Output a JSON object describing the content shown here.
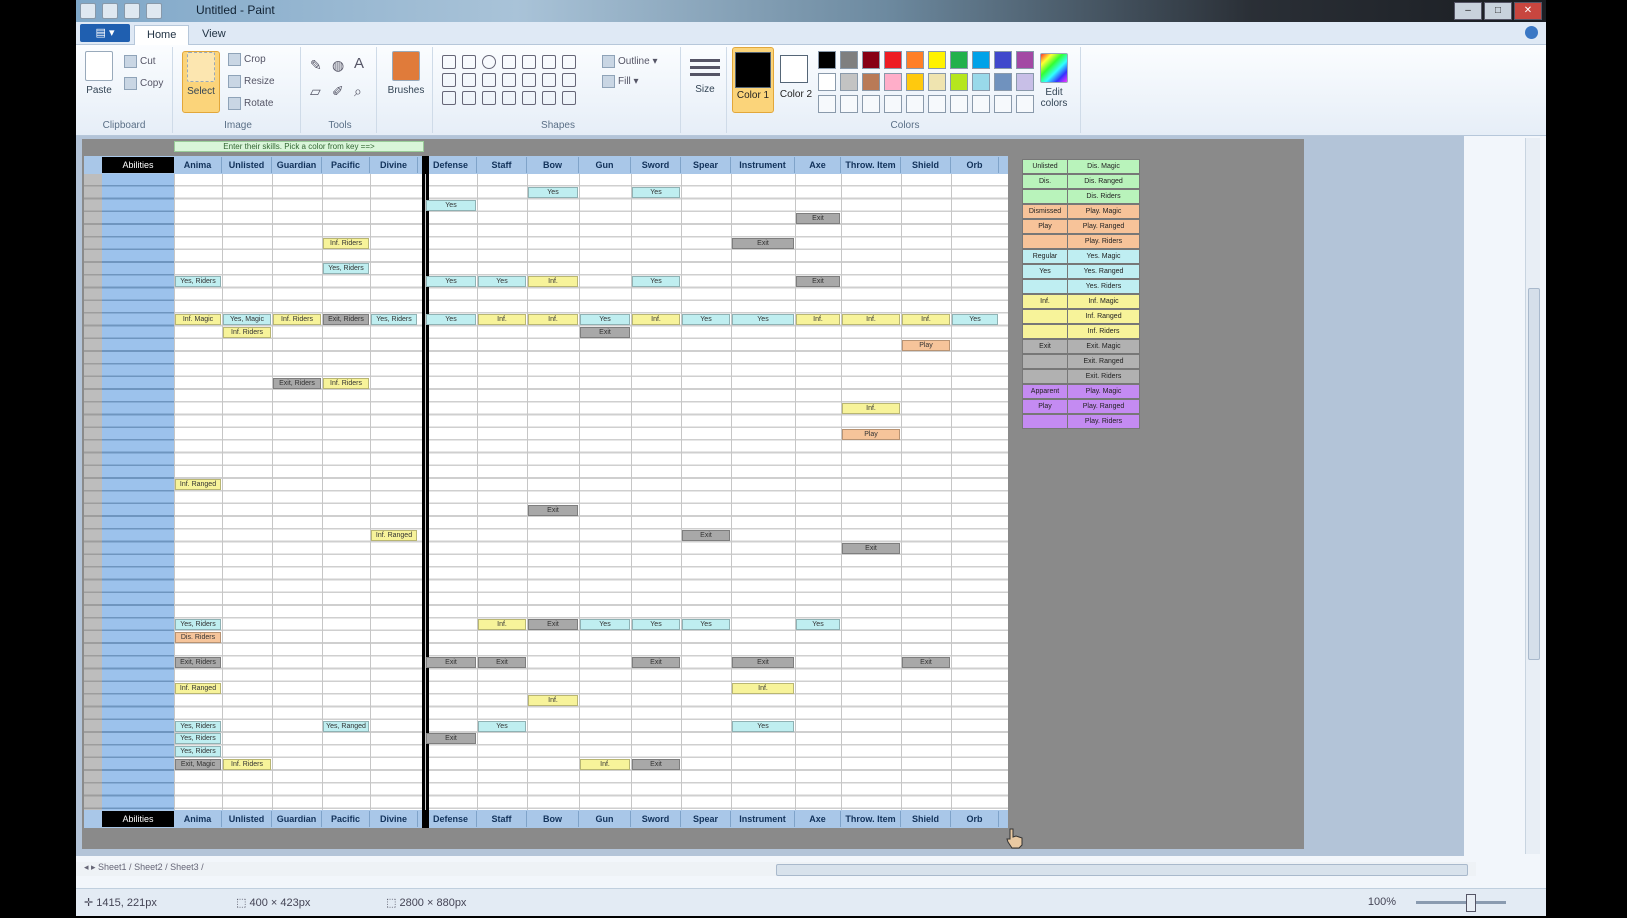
{
  "window": {
    "title": "Untitled - Paint"
  },
  "tabs": [
    {
      "label": "Home"
    },
    {
      "label": "View"
    }
  ],
  "ribbon": {
    "clipboard": {
      "label": "Clipboard",
      "paste": "Paste",
      "cut": "Cut",
      "copy": "Copy"
    },
    "image": {
      "label": "Image",
      "select": "Select",
      "crop": "Crop",
      "resize": "Resize",
      "rotate": "Rotate"
    },
    "tools": {
      "label": "Tools"
    },
    "brushes": {
      "label": "Brushes"
    },
    "shapes": {
      "label": "Shapes",
      "outline": "Outline",
      "fill": "Fill"
    },
    "size": {
      "label": "Size"
    },
    "colors": {
      "label": "Colors",
      "color1": "Color 1",
      "color2": "Color 2",
      "edit": "Edit colors"
    },
    "palette": [
      "#000000",
      "#7f7f7f",
      "#880015",
      "#ed1c24",
      "#ff7f27",
      "#fff200",
      "#22b14c",
      "#00a2e8",
      "#3f48cc",
      "#a349a4",
      "#ffffff",
      "#c3c3c3",
      "#b97a57",
      "#ffaec9",
      "#ffc90e",
      "#efe4b0",
      "#b5e61d",
      "#99d9ea",
      "#7092be",
      "#c8bfe7"
    ]
  },
  "sheet": {
    "note": "Enter their skills. Pick a color from key ==>",
    "corner": "Abilities",
    "columns": [
      "Anima",
      "Unlisted",
      "Guardian",
      "Pacific",
      "Divine",
      "Defense",
      "Staff",
      "Bow",
      "Gun",
      "Sword",
      "Spear",
      "Instrument",
      "Axe",
      "Throw. Item",
      "Shield",
      "Orb"
    ],
    "cells": [
      {
        "col": 7,
        "row": 1,
        "text": "Yes",
        "color": "blue"
      },
      {
        "col": 9,
        "row": 1,
        "text": "Yes",
        "color": "blue"
      },
      {
        "col": 5,
        "row": 2,
        "text": "Yes",
        "color": "blue"
      },
      {
        "col": 12,
        "row": 3,
        "text": "Exit",
        "color": "gray"
      },
      {
        "col": 3,
        "row": 5,
        "text": "Inf. Riders",
        "color": "yellow"
      },
      {
        "col": 11,
        "row": 5,
        "text": "Exit",
        "color": "gray"
      },
      {
        "col": 3,
        "row": 7,
        "text": "Yes, Riders",
        "color": "blue"
      },
      {
        "col": 0,
        "row": 8,
        "text": "Yes, Riders",
        "color": "blue"
      },
      {
        "col": 5,
        "row": 8,
        "text": "Yes",
        "color": "blue"
      },
      {
        "col": 6,
        "row": 8,
        "text": "Yes",
        "color": "blue"
      },
      {
        "col": 7,
        "row": 8,
        "text": "Inf.",
        "color": "yellow"
      },
      {
        "col": 9,
        "row": 8,
        "text": "Yes",
        "color": "blue"
      },
      {
        "col": 12,
        "row": 8,
        "text": "Exit",
        "color": "gray"
      },
      {
        "col": 0,
        "row": 11,
        "text": "Inf. Magic",
        "color": "yellow"
      },
      {
        "col": 1,
        "row": 11,
        "text": "Yes, Magic",
        "color": "blue"
      },
      {
        "col": 2,
        "row": 11,
        "text": "Inf. Riders",
        "color": "yellow"
      },
      {
        "col": 3,
        "row": 11,
        "text": "Exit, Riders",
        "color": "gray"
      },
      {
        "col": 4,
        "row": 11,
        "text": "Yes, Riders",
        "color": "blue"
      },
      {
        "col": 5,
        "row": 11,
        "text": "Yes",
        "color": "blue"
      },
      {
        "col": 6,
        "row": 11,
        "text": "Inf.",
        "color": "yellow"
      },
      {
        "col": 7,
        "row": 11,
        "text": "Inf.",
        "color": "yellow"
      },
      {
        "col": 8,
        "row": 11,
        "text": "Yes",
        "color": "blue"
      },
      {
        "col": 9,
        "row": 11,
        "text": "Inf.",
        "color": "yellow"
      },
      {
        "col": 10,
        "row": 11,
        "text": "Yes",
        "color": "blue"
      },
      {
        "col": 11,
        "row": 11,
        "text": "Yes",
        "color": "blue"
      },
      {
        "col": 12,
        "row": 11,
        "text": "Inf.",
        "color": "yellow"
      },
      {
        "col": 13,
        "row": 11,
        "text": "Inf.",
        "color": "yellow"
      },
      {
        "col": 14,
        "row": 11,
        "text": "Inf.",
        "color": "yellow"
      },
      {
        "col": 15,
        "row": 11,
        "text": "Yes",
        "color": "blue"
      },
      {
        "col": 1,
        "row": 12,
        "text": "Inf. Riders",
        "color": "yellow"
      },
      {
        "col": 8,
        "row": 12,
        "text": "Exit",
        "color": "gray"
      },
      {
        "col": 14,
        "row": 13,
        "text": "Play",
        "color": "orange"
      },
      {
        "col": 2,
        "row": 16,
        "text": "Exit, Riders",
        "color": "gray"
      },
      {
        "col": 3,
        "row": 16,
        "text": "Inf. Riders",
        "color": "yellow"
      },
      {
        "col": 13,
        "row": 18,
        "text": "Inf.",
        "color": "yellow"
      },
      {
        "col": 13,
        "row": 20,
        "text": "Play",
        "color": "orange"
      },
      {
        "col": 0,
        "row": 24,
        "text": "Inf. Ranged",
        "color": "yellow"
      },
      {
        "col": 7,
        "row": 26,
        "text": "Exit",
        "color": "gray"
      },
      {
        "col": 4,
        "row": 28,
        "text": "Inf. Ranged",
        "color": "yellow"
      },
      {
        "col": 10,
        "row": 28,
        "text": "Exit",
        "color": "gray"
      },
      {
        "col": 13,
        "row": 29,
        "text": "Exit",
        "color": "gray"
      },
      {
        "col": 0,
        "row": 35,
        "text": "Yes, Riders",
        "color": "blue"
      },
      {
        "col": 6,
        "row": 35,
        "text": "Inf.",
        "color": "yellow"
      },
      {
        "col": 7,
        "row": 35,
        "text": "Exit",
        "color": "gray"
      },
      {
        "col": 8,
        "row": 35,
        "text": "Yes",
        "color": "blue"
      },
      {
        "col": 9,
        "row": 35,
        "text": "Yes",
        "color": "blue"
      },
      {
        "col": 10,
        "row": 35,
        "text": "Yes",
        "color": "blue"
      },
      {
        "col": 12,
        "row": 35,
        "text": "Yes",
        "color": "blue"
      },
      {
        "col": 0,
        "row": 36,
        "text": "Dis. Riders",
        "color": "orange"
      },
      {
        "col": 0,
        "row": 38,
        "text": "Exit, Riders",
        "color": "gray"
      },
      {
        "col": 5,
        "row": 38,
        "text": "Exit",
        "color": "gray"
      },
      {
        "col": 6,
        "row": 38,
        "text": "Exit",
        "color": "gray"
      },
      {
        "col": 9,
        "row": 38,
        "text": "Exit",
        "color": "gray"
      },
      {
        "col": 11,
        "row": 38,
        "text": "Exit",
        "color": "gray"
      },
      {
        "col": 14,
        "row": 38,
        "text": "Exit",
        "color": "gray"
      },
      {
        "col": 0,
        "row": 40,
        "text": "Inf. Ranged",
        "color": "yellow"
      },
      {
        "col": 11,
        "row": 40,
        "text": "Inf.",
        "color": "yellow"
      },
      {
        "col": 7,
        "row": 41,
        "text": "Inf.",
        "color": "yellow"
      },
      {
        "col": 0,
        "row": 43,
        "text": "Yes, Riders",
        "color": "blue"
      },
      {
        "col": 3,
        "row": 43,
        "text": "Yes, Ranged",
        "color": "blue"
      },
      {
        "col": 6,
        "row": 43,
        "text": "Yes",
        "color": "blue"
      },
      {
        "col": 11,
        "row": 43,
        "text": "Yes",
        "color": "blue"
      },
      {
        "col": 0,
        "row": 44,
        "text": "Yes, Riders",
        "color": "blue"
      },
      {
        "col": 5,
        "row": 44,
        "text": "Exit",
        "color": "gray"
      },
      {
        "col": 0,
        "row": 45,
        "text": "Yes, Riders",
        "color": "blue"
      },
      {
        "col": 0,
        "row": 46,
        "text": "Exit, Magic",
        "color": "gray"
      },
      {
        "col": 1,
        "row": 46,
        "text": "Inf. Riders",
        "color": "yellow"
      },
      {
        "col": 8,
        "row": 46,
        "text": "Inf.",
        "color": "yellow"
      },
      {
        "col": 9,
        "row": 46,
        "text": "Exit",
        "color": "gray"
      }
    ],
    "legend": [
      {
        "color": "green",
        "left": "Unlisted",
        "right": "Dis. Magic"
      },
      {
        "color": "green",
        "left": "Dis.",
        "right": "Dis. Ranged"
      },
      {
        "color": "green",
        "left": "",
        "right": "Dis. Riders"
      },
      {
        "color": "orange",
        "left": "Dismissed",
        "right": "Play. Magic"
      },
      {
        "color": "orange",
        "left": "Play",
        "right": "Play. Ranged"
      },
      {
        "color": "orange",
        "left": "",
        "right": "Play. Riders"
      },
      {
        "color": "blue",
        "left": "Regular",
        "right": "Yes. Magic"
      },
      {
        "color": "blue",
        "left": "Yes",
        "right": "Yes. Ranged"
      },
      {
        "color": "blue",
        "left": "",
        "right": "Yes. Riders"
      },
      {
        "color": "yellow",
        "left": "Inf.",
        "right": "Inf. Magic"
      },
      {
        "color": "yellow",
        "left": "",
        "right": "Inf. Ranged"
      },
      {
        "color": "yellow",
        "left": "",
        "right": "Inf. Riders"
      },
      {
        "color": "gray",
        "left": "Exit",
        "right": "Exit. Magic"
      },
      {
        "color": "gray",
        "left": "",
        "right": "Exit. Ranged"
      },
      {
        "color": "gray",
        "left": "",
        "right": "Exit. Riders"
      },
      {
        "color": "purple",
        "left": "Apparent",
        "right": "Play. Magic"
      },
      {
        "color": "purple",
        "left": "Play",
        "right": "Play. Ranged"
      },
      {
        "color": "purple",
        "left": "",
        "right": "Play. Riders"
      }
    ]
  },
  "status": {
    "cursor": "1415, 221px",
    "selection": "400 × 423px",
    "size": "2800 × 880px",
    "zoom": "100%"
  },
  "sheet_tabs": "◂ ▸  Sheet1 /  Sheet2 / Sheet3 /"
}
